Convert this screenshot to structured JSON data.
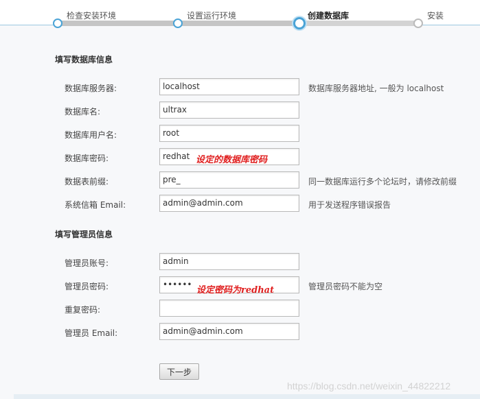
{
  "steps": [
    {
      "label": "检查安装环境",
      "state": "done"
    },
    {
      "label": "设置运行环境",
      "state": "done"
    },
    {
      "label": "创建数据库",
      "state": "current"
    },
    {
      "label": "安装",
      "state": "pending"
    }
  ],
  "db_section": {
    "title": "填写数据库信息",
    "fields": [
      {
        "label": "数据库服务器:",
        "value": "localhost",
        "hint": "数据库服务器地址, 一般为 localhost"
      },
      {
        "label": "数据库名:",
        "value": "ultrax",
        "hint": ""
      },
      {
        "label": "数据库用户名:",
        "value": "root",
        "hint": ""
      },
      {
        "label": "数据库密码:",
        "value": "redhat",
        "hint": ""
      },
      {
        "label": "数据表前缀:",
        "value": "pre_",
        "hint": "同一数据库运行多个论坛时，请修改前缀"
      },
      {
        "label": "系统信箱 Email:",
        "value": "admin@admin.com",
        "hint": "用于发送程序错误报告"
      }
    ],
    "annotation": "设定的数据库密码"
  },
  "admin_section": {
    "title": "填写管理员信息",
    "fields": [
      {
        "label": "管理员账号:",
        "value": "admin",
        "hint": ""
      },
      {
        "label": "管理员密码:",
        "value": "••••••",
        "hint": "管理员密码不能为空"
      },
      {
        "label": "重复密码:",
        "value": "",
        "hint": ""
      },
      {
        "label": "管理员 Email:",
        "value": "admin@admin.com",
        "hint": ""
      }
    ],
    "annotation": "设定密码为redhat"
  },
  "next_button": "下一步",
  "watermark": "https://blog.csdn.net/weixin_44822212",
  "colors": {
    "accent": "#4aa3d6",
    "annotation": "#e02020"
  }
}
